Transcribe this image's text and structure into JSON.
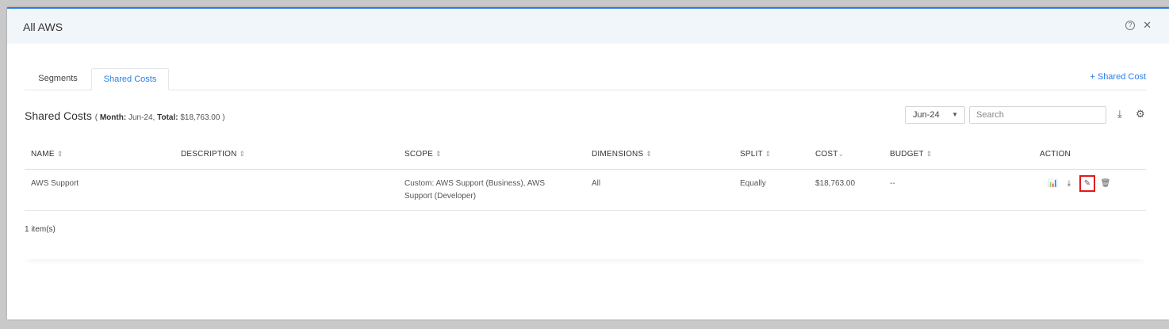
{
  "modal": {
    "title": "All AWS"
  },
  "header_icons": {
    "help": "?",
    "close": "✕"
  },
  "tabs": [
    {
      "label": "Segments",
      "active": false
    },
    {
      "label": "Shared Costs",
      "active": true
    }
  ],
  "add_shared_cost_label": "+ Shared Cost",
  "section": {
    "title": "Shared Costs",
    "open": "(",
    "month_label": "Month:",
    "month_value": " Jun-24, ",
    "total_label": "Total:",
    "total_value": " $18,763.00 ",
    "close": ")"
  },
  "month_select": {
    "value": "Jun-24"
  },
  "search": {
    "placeholder": "Search"
  },
  "table": {
    "columns": [
      {
        "label": "NAME",
        "sort": "⇕"
      },
      {
        "label": "DESCRIPTION",
        "sort": "⇕"
      },
      {
        "label": "SCOPE",
        "sort": "⇕"
      },
      {
        "label": "DIMENSIONS",
        "sort": "⇕"
      },
      {
        "label": "SPLIT",
        "sort": "⇕"
      },
      {
        "label": "COST",
        "sort": "⌄"
      },
      {
        "label": "BUDGET",
        "sort": "⇕"
      },
      {
        "label": "ACTION",
        "sort": ""
      }
    ],
    "rows": [
      {
        "name": "AWS Support",
        "description": "",
        "scope_line1": "Custom: AWS Support (Business), AWS",
        "scope_line2": "Support (Developer)",
        "dimensions": "All",
        "split": "Equally",
        "cost": "$18,763.00",
        "budget": "--"
      }
    ]
  },
  "footer": {
    "count": "1 item(s)"
  },
  "accent_color": "#2b7de9",
  "highlight_color": "#e01b1b"
}
